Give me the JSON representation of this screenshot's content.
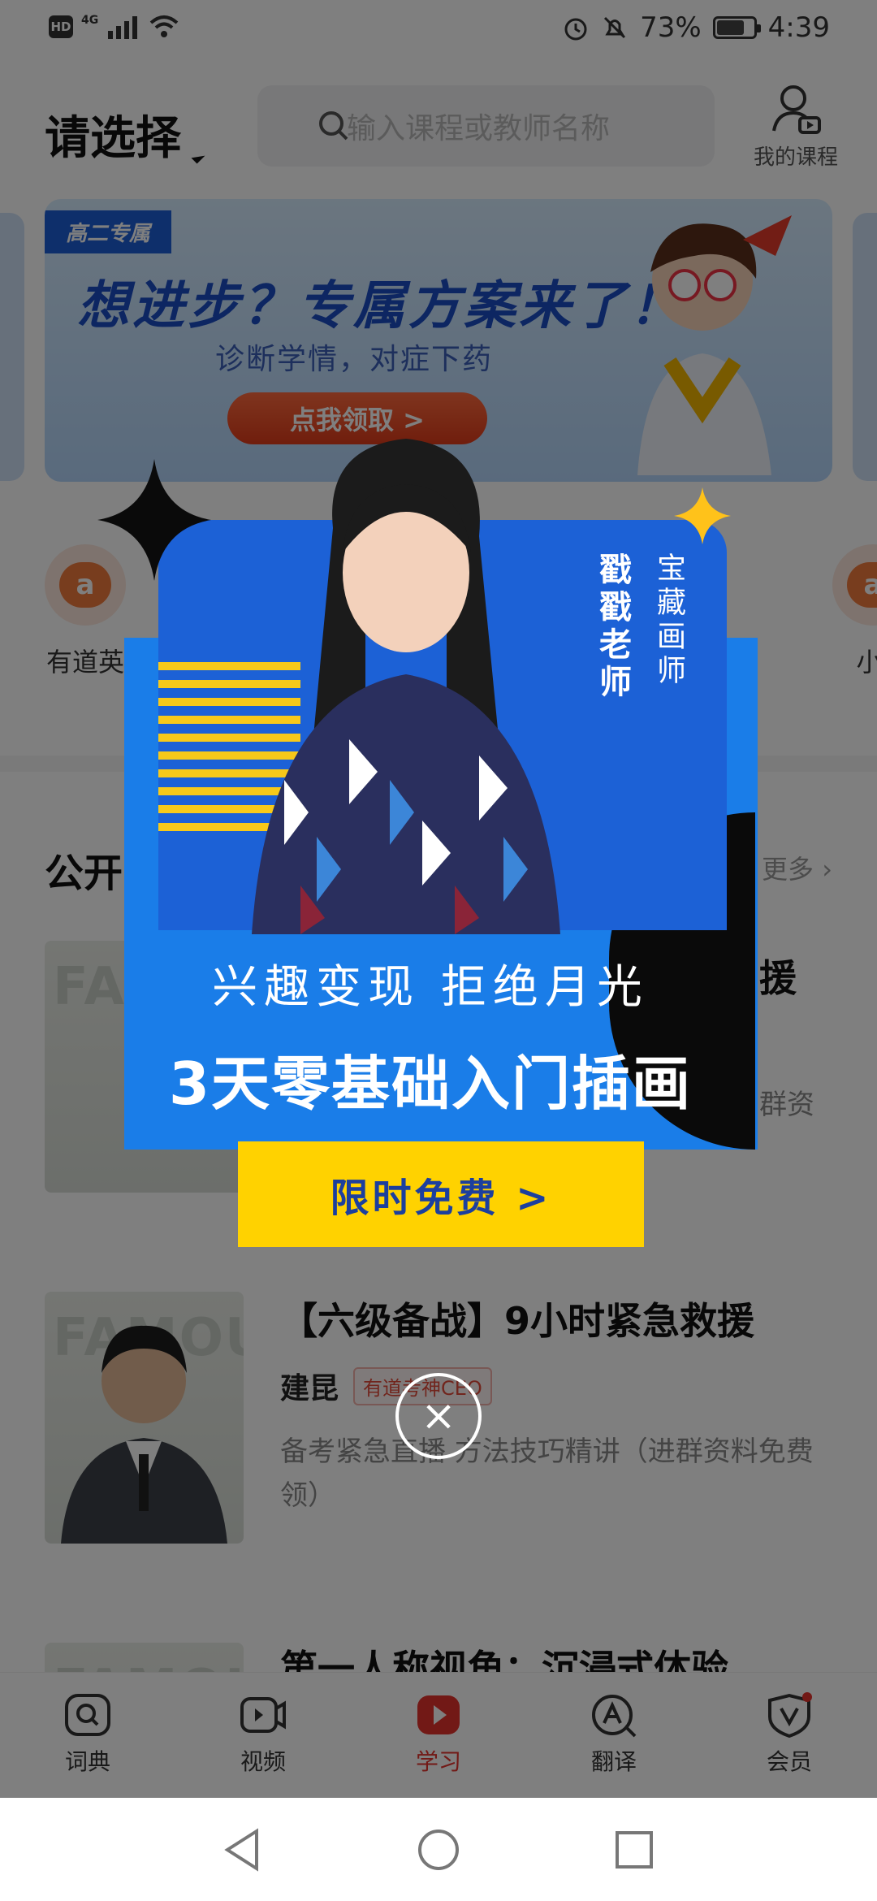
{
  "status_bar": {
    "hd": "HD",
    "network": "4G",
    "battery": "73%",
    "battery_level": 0.73,
    "time": "4:39"
  },
  "header": {
    "selector_label": "请选择",
    "search_placeholder": "输入课程或教师名称",
    "my_course_label": "我的课程"
  },
  "banner": {
    "tag": "高二专属",
    "title": "想进步？专属方案来了！",
    "subtitle": "诊断学情，对症下药",
    "button": "点我领取 >",
    "colors": {
      "title": "#1a4cc4",
      "button": "#e03b1a"
    }
  },
  "quick_entries": [
    {
      "label": "有道英",
      "icon": "chat-bubble-icon"
    },
    {
      "label": "小i",
      "icon": "chat-bubble-icon"
    }
  ],
  "section": {
    "title": "公开",
    "more": "更多"
  },
  "courses": [
    {
      "thumb_text": "FA",
      "title": "援",
      "desc": "群资"
    },
    {
      "thumb_text": "FAMOUS",
      "title": "【六级备战】9小时紧急救援",
      "teacher": "建昆",
      "badge": "有道考神CEO",
      "desc": "备考紧急直播 方法技巧精讲（进群资料免费领）"
    },
    {
      "thumb_text": "FAMOUS",
      "title": "第一人称视角：沉浸式体验"
    }
  ],
  "tabbar": [
    {
      "label": "词典",
      "icon": "dictionary-search-icon",
      "active": false
    },
    {
      "label": "视频",
      "icon": "video-icon",
      "active": false
    },
    {
      "label": "学习",
      "icon": "play-study-icon",
      "active": true
    },
    {
      "label": "翻译",
      "icon": "translate-icon",
      "active": false
    },
    {
      "label": "会员",
      "icon": "vip-shield-icon",
      "active": false
    }
  ],
  "popup": {
    "tag_main": "戳戳老师",
    "tag_sub": "宝藏画师",
    "line1": "兴趣变现 拒绝月光",
    "line2": "3天零基础入门插画",
    "button": "限时免费 >",
    "colors": {
      "background": "#1a7de8",
      "button": "#ffd200",
      "stripe": "#f7c91a"
    }
  },
  "close_icon": "×"
}
